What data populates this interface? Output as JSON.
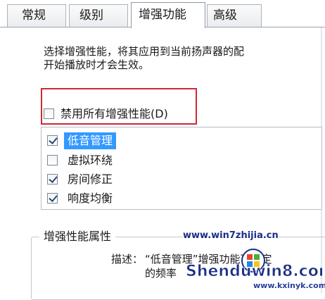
{
  "tabs": [
    {
      "label": "常规",
      "active": false
    },
    {
      "label": "级别",
      "active": false
    },
    {
      "label": "增强功能",
      "active": true
    },
    {
      "label": "高级",
      "active": false
    }
  ],
  "description": {
    "line1": "选择增强性能，将其应用到当前扬声器的配",
    "line2": "开始播放时才会生效。"
  },
  "disable_all": {
    "label": "禁用所有增强性能(D)",
    "checked": false
  },
  "enhancements": [
    {
      "label": "低音管理",
      "checked": true,
      "selected": true
    },
    {
      "label": "虚拟环绕",
      "checked": false,
      "selected": false
    },
    {
      "label": "房间修正",
      "checked": true,
      "selected": false
    },
    {
      "label": "响度均衡",
      "checked": true,
      "selected": false
    }
  ],
  "properties": {
    "title": "增强性能属性",
    "desc_prefix": "描述：",
    "desc_text": "“低音管理”增强功能可确定",
    "desc_line2": "的频率"
  },
  "watermark": {
    "url1": "www.win7zhijia.cn",
    "logo_text": "Shenduwin8.com",
    "url2": "www.kxinyk.com"
  },
  "colors": {
    "highlight": "#3399ff",
    "red_box": "#cc2a36",
    "watermark_blue": "#1a2f86"
  }
}
